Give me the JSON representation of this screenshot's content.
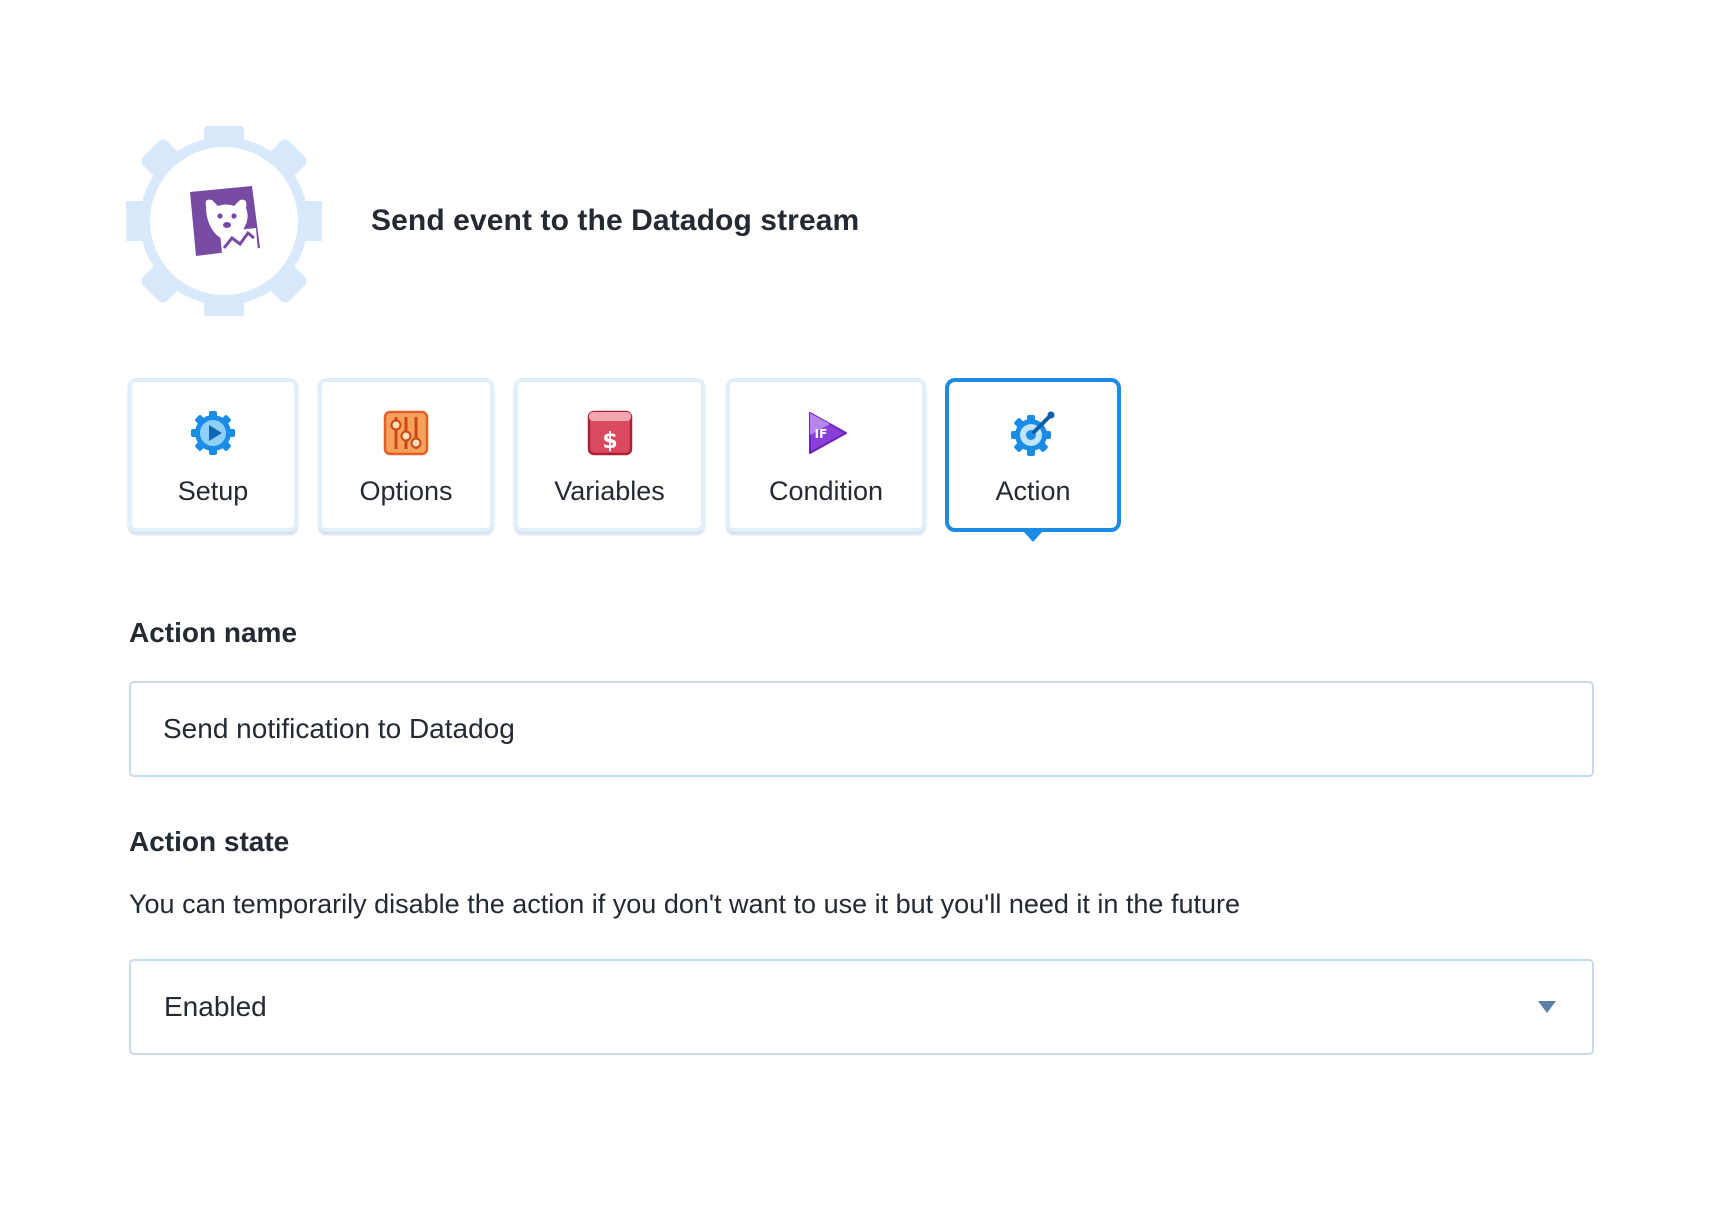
{
  "header": {
    "app_icon": "datadog-logo-icon",
    "title": "Send event to the Datadog stream"
  },
  "tabs": [
    {
      "label": "Setup",
      "icon": "setup-gear-play-icon",
      "active": false
    },
    {
      "label": "Options",
      "icon": "sliders-icon",
      "active": false
    },
    {
      "label": "Variables",
      "icon": "dollar-card-icon",
      "active": false
    },
    {
      "label": "Condition",
      "icon": "if-play-icon",
      "active": false
    },
    {
      "label": "Action",
      "icon": "action-gear-icon",
      "active": true
    }
  ],
  "form": {
    "action_name_label": "Action name",
    "action_name_value": "Send notification to Datadog",
    "action_state_label": "Action state",
    "action_state_help": "You can temporarily disable the action if you don't want to use it but you'll need it in the future",
    "action_state_value": "Enabled"
  },
  "colors": {
    "accent": "#1b8ce6",
    "tab_border": "#e3eefb",
    "input_border": "#c9d9ef",
    "datadog_purple": "#774aa4"
  }
}
